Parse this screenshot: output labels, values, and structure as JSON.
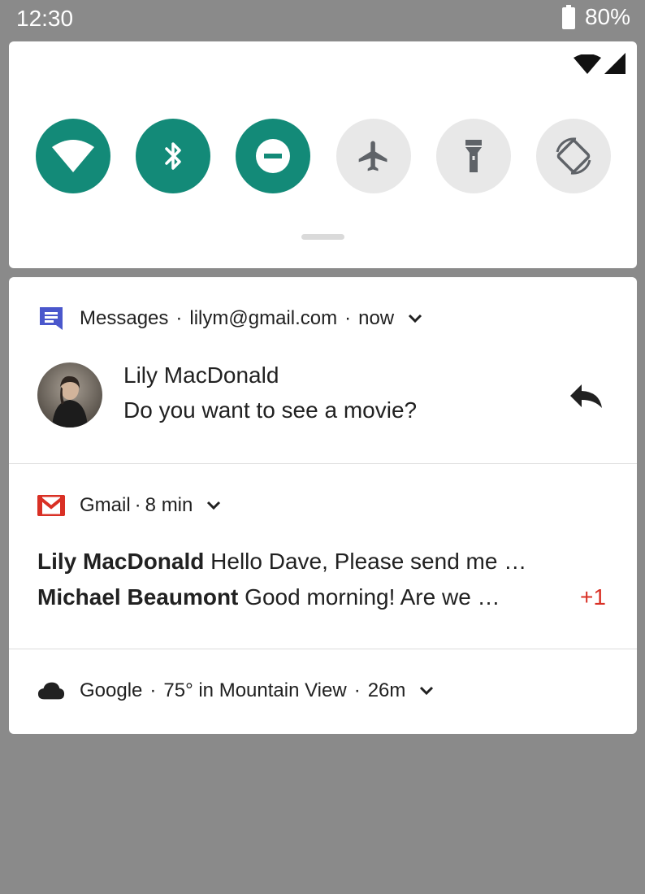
{
  "status_bar": {
    "time": "12:30",
    "battery": "80%"
  },
  "quick_settings": {
    "tiles": [
      {
        "name": "wifi",
        "state": "on",
        "icon": "wifi-icon"
      },
      {
        "name": "bluetooth",
        "state": "on",
        "icon": "bluetooth-icon"
      },
      {
        "name": "do-not-disturb",
        "state": "on",
        "icon": "do-not-disturb-icon"
      },
      {
        "name": "airplane",
        "state": "off",
        "icon": "airplane-icon"
      },
      {
        "name": "flashlight",
        "state": "off",
        "icon": "flashlight-icon"
      },
      {
        "name": "auto-rotate",
        "state": "off",
        "icon": "auto-rotate-icon"
      }
    ],
    "active_color": "#138a78",
    "inactive_color": "#e8e8e8"
  },
  "notifications": {
    "messages": {
      "app": "Messages",
      "account": "lilym@gmail.com",
      "time": "now",
      "sender": "Lily MacDonald",
      "text": "Do you want to see a movie?",
      "icon": "messages-icon",
      "action_icon": "reply-icon"
    },
    "gmail": {
      "app": "Gmail",
      "time": "8 min",
      "icon": "gmail-icon",
      "lines": [
        {
          "sender": "Lily MacDonald",
          "preview": "Hello Dave,  Please send me  …"
        },
        {
          "sender": "Michael Beaumont",
          "preview": "Good morning! Are we …"
        }
      ],
      "more_count": "+1",
      "accent": "#d93025"
    },
    "google": {
      "app": "Google",
      "summary": "75° in Mountain View",
      "time": "26m",
      "icon": "cloud-icon"
    }
  },
  "separator": "·"
}
